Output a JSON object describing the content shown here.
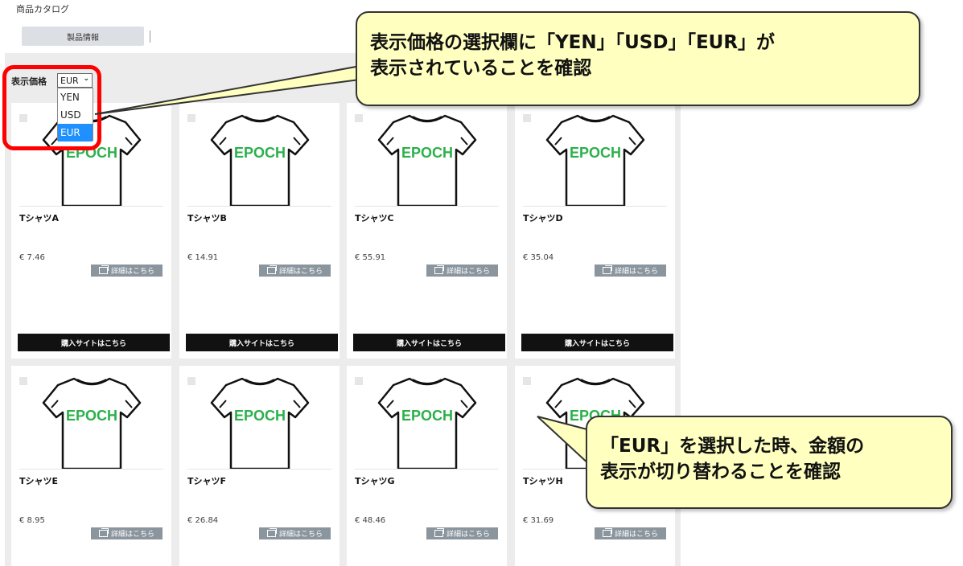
{
  "header": {
    "title": "商品カタログ",
    "tab_label": "製品情報"
  },
  "price_selector": {
    "label": "表示価格",
    "selected": "EUR",
    "options": [
      "YEN",
      "USD",
      "EUR"
    ]
  },
  "products": [
    {
      "name": "TシャツA",
      "price": "€ 7.46",
      "shirt_text": "EPOCH",
      "detail_label": "詳細はこちら",
      "buy_label": "購入サイトはこちら"
    },
    {
      "name": "TシャツB",
      "price": "€ 14.91",
      "shirt_text": "EPOCH",
      "detail_label": "詳細はこちら",
      "buy_label": "購入サイトはこちら"
    },
    {
      "name": "TシャツC",
      "price": "€ 55.91",
      "shirt_text": "EPOCH",
      "detail_label": "詳細はこちら",
      "buy_label": "購入サイトはこちら"
    },
    {
      "name": "TシャツD",
      "price": "€ 35.04",
      "shirt_text": "EPOCH",
      "detail_label": "詳細はこちら",
      "buy_label": "購入サイトはこちら"
    },
    {
      "name": "TシャツE",
      "price": "€ 8.95",
      "shirt_text": "EPOCH",
      "detail_label": "詳細はこちら"
    },
    {
      "name": "TシャツF",
      "price": "€ 26.84",
      "shirt_text": "EPOCH",
      "detail_label": "詳細はこちら"
    },
    {
      "name": "TシャツG",
      "price": "€ 48.46",
      "shirt_text": "EPOCH",
      "detail_label": "詳細はこちら"
    },
    {
      "name": "TシャツH",
      "price": "€ 31.69",
      "shirt_text": "EPOCH",
      "detail_label": "詳細はこちら"
    }
  ],
  "annotations": {
    "callout_1": [
      "表示価格の選択欄に「YEN」「USD」「EUR」が",
      "表示されていることを確認"
    ],
    "callout_2": [
      "「EUR」を選択した時、金額の",
      "表示が切り替わることを確認"
    ]
  },
  "colors": {
    "brand_green": "#2bb04a",
    "highlight_red": "#ff0000",
    "callout_fill": "#ffffc0",
    "selected_option": "#1e90ff",
    "buy_button": "#111111",
    "detail_button": "#8a959e"
  },
  "icons": {
    "shirt": "t-shirt-icon",
    "detail": "external-window-icon",
    "select": "chevron-down-icon"
  }
}
